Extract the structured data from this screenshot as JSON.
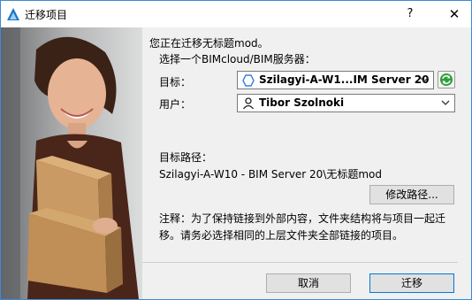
{
  "window": {
    "title": "迁移项目",
    "help_label": "?",
    "close_label": "✕"
  },
  "dialog": {
    "intro": "您正在迁移无标题mod。",
    "choose_server": "选择一个BIMcloud/BIM服务器：",
    "target_label": "目标：",
    "target_value": "Szilagyi-A-W1...IM Server 20",
    "user_label": "用户：",
    "user_value": "Tibor Szolnoki",
    "path_label": "目标路径：",
    "path_value": "Szilagyi-A-W10 - BIM Server 20\\无标题mod",
    "modify_path_button": "修改路径...",
    "note_line1": "注释：为了保持链接到外部内容，文件夹结构将与项目一起迁",
    "note_line2": "移。请务必选择相同的上层文件夹全部链接的项目。",
    "cancel_button": "取消",
    "migrate_button": "迁移"
  },
  "colors": {
    "window_border": "#3c8ad6",
    "accent_blue": "#0078d7",
    "sync_green": "#2e9e3a",
    "cloud_icon_blue": "#3a7fd5"
  },
  "icons": {
    "app": "archicad-app-icon",
    "target": "hexagon-server-icon",
    "user": "user-icon",
    "sync": "sync-icon",
    "dropdown": "chevron-down-icon"
  }
}
